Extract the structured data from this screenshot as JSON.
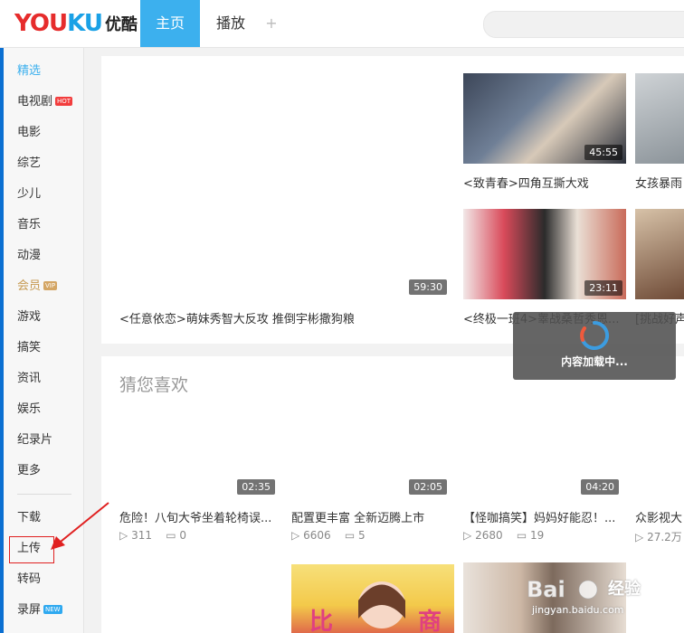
{
  "header": {
    "logo_text": "YOUKU",
    "logo_cn": "优酷",
    "tabs": [
      "主页",
      "播放"
    ],
    "add_tab": "+"
  },
  "sidebar": {
    "items": [
      {
        "label": "精选"
      },
      {
        "label": "电视剧",
        "badge": "HOT"
      },
      {
        "label": "电影"
      },
      {
        "label": "综艺"
      },
      {
        "label": "少儿"
      },
      {
        "label": "音乐"
      },
      {
        "label": "动漫"
      },
      {
        "label": "会员",
        "badge": "VIP"
      },
      {
        "label": "游戏"
      },
      {
        "label": "搞笑"
      },
      {
        "label": "资讯"
      },
      {
        "label": "娱乐"
      },
      {
        "label": "纪录片"
      },
      {
        "label": "更多"
      }
    ],
    "tools": [
      {
        "label": "下载"
      },
      {
        "label": "上传"
      },
      {
        "label": "转码"
      },
      {
        "label": "录屏",
        "badge": "NEW"
      }
    ]
  },
  "featured": {
    "main": {
      "title": "<任意依恋>萌妹秀智大反攻 推倒宇彬撒狗粮",
      "duration": "59:30"
    },
    "items": [
      {
        "title": "<致青春>四角互撕大戏",
        "duration": "45:55"
      },
      {
        "title": "女孩暴雨",
        "duration": ""
      },
      {
        "title": "<终极一班4>睾战桑哲秀恩...",
        "duration": "23:11"
      },
      {
        "title": "[挑战好声",
        "duration": ""
      }
    ]
  },
  "recommend": {
    "title": "猜您喜欢",
    "items": [
      {
        "title": "危险！八旬大爷坐着轮椅误...",
        "duration": "02:35",
        "plays": "311",
        "comments": "0"
      },
      {
        "title": "配置更丰富 全新迈腾上市",
        "duration": "02:05",
        "plays": "6606",
        "comments": "5"
      },
      {
        "title": "【怪咖搞笑】妈妈好能忍！...",
        "duration": "04:20",
        "plays": "2680",
        "comments": "19"
      },
      {
        "title": "众影视大",
        "duration": "",
        "plays": "27.2万",
        "comments": ""
      }
    ]
  },
  "loading": {
    "text": "内容加载中..."
  },
  "watermark": {
    "brand": "Baidu",
    "sub": "经验",
    "url": "jingyan.baidu.com"
  },
  "colors": {
    "accent": "#3cb0ee",
    "hot": "#f23d3d",
    "vip": "#c69a52",
    "highlight": "#e02020"
  }
}
